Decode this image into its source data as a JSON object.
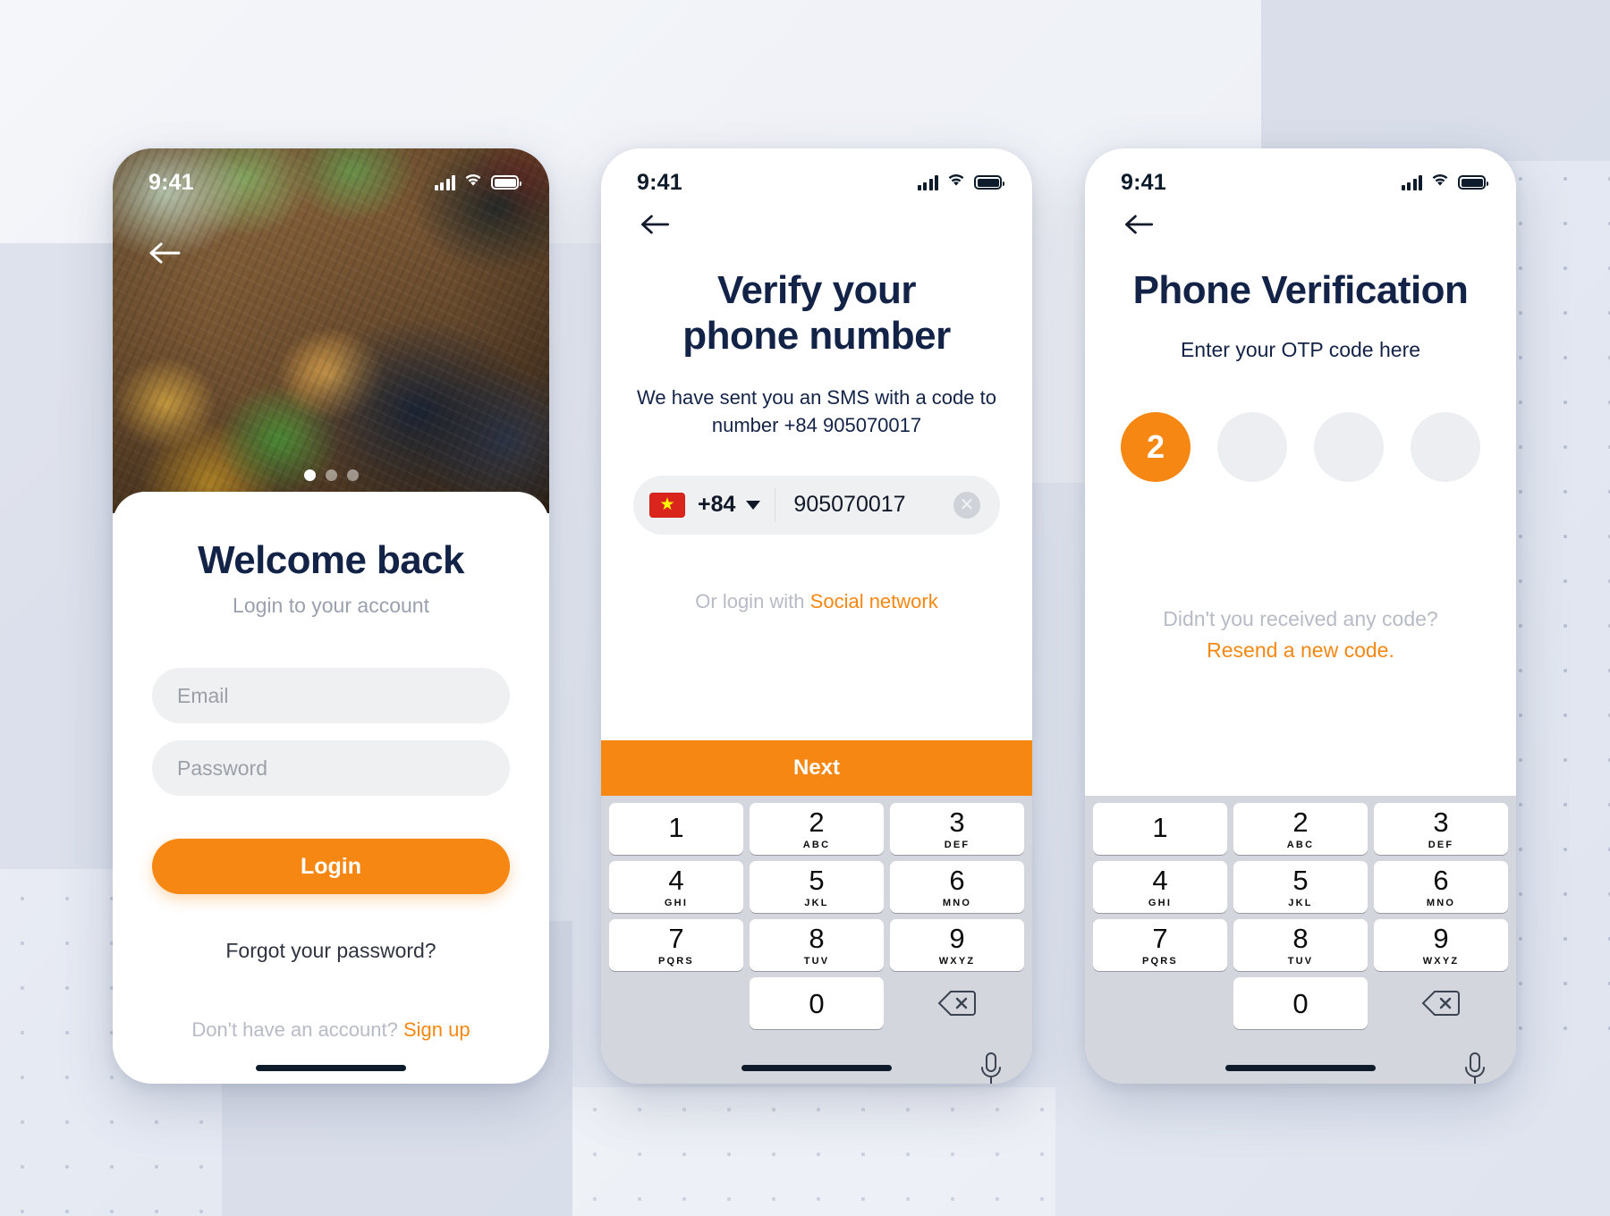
{
  "status_bar": {
    "time": "9:41",
    "icons": [
      "cellular-signal-icon",
      "wifi-icon",
      "battery-icon"
    ]
  },
  "screen_login": {
    "back_icon": "back-arrow-icon",
    "pager": {
      "total": 3,
      "active_index": 0
    },
    "title": "Welcome back",
    "subtitle": "Login to your account",
    "email_placeholder": "Email",
    "password_placeholder": "Password",
    "login_label": "Login",
    "forgot_label": "Forgot your password?",
    "signup_prefix": "Don't have an account? ",
    "signup_link": "Sign up"
  },
  "screen_verify": {
    "back_icon": "back-arrow-icon",
    "title_line1": "Verify your",
    "title_line2": "phone number",
    "description_line1": "We have sent you an SMS with a code to",
    "description_line2": "number +84 905070017",
    "country_flag": "vietnam-flag-icon",
    "flag_star": "★",
    "dial_code": "+84",
    "caret_icon": "chevron-down-icon",
    "phone_number": "905070017",
    "clear_icon": "clear-circle-icon",
    "social_prefix": "Or login with ",
    "social_link": "Social network",
    "next_label": "Next"
  },
  "screen_otp": {
    "back_icon": "back-arrow-icon",
    "title": "Phone Verification",
    "subtitle": "Enter your OTP code here",
    "otp_digits": [
      "2",
      "",
      "",
      ""
    ],
    "resend_question": "Didn't you received any code?",
    "resend_link": "Resend a new code."
  },
  "keyboard": {
    "keys": [
      {
        "num": "1",
        "sub": ""
      },
      {
        "num": "2",
        "sub": "ABC"
      },
      {
        "num": "3",
        "sub": "DEF"
      },
      {
        "num": "4",
        "sub": "GHI"
      },
      {
        "num": "5",
        "sub": "JKL"
      },
      {
        "num": "6",
        "sub": "MNO"
      },
      {
        "num": "7",
        "sub": "PQRS"
      },
      {
        "num": "8",
        "sub": "TUV"
      },
      {
        "num": "9",
        "sub": "WXYZ"
      },
      {
        "num": "0",
        "sub": ""
      }
    ],
    "backspace_icon": "backspace-icon",
    "mic_icon": "microphone-icon"
  },
  "colors": {
    "accent": "#f68712",
    "navy": "#132347",
    "muted": "#b7bbc6",
    "field_bg": "#eff0f2"
  }
}
